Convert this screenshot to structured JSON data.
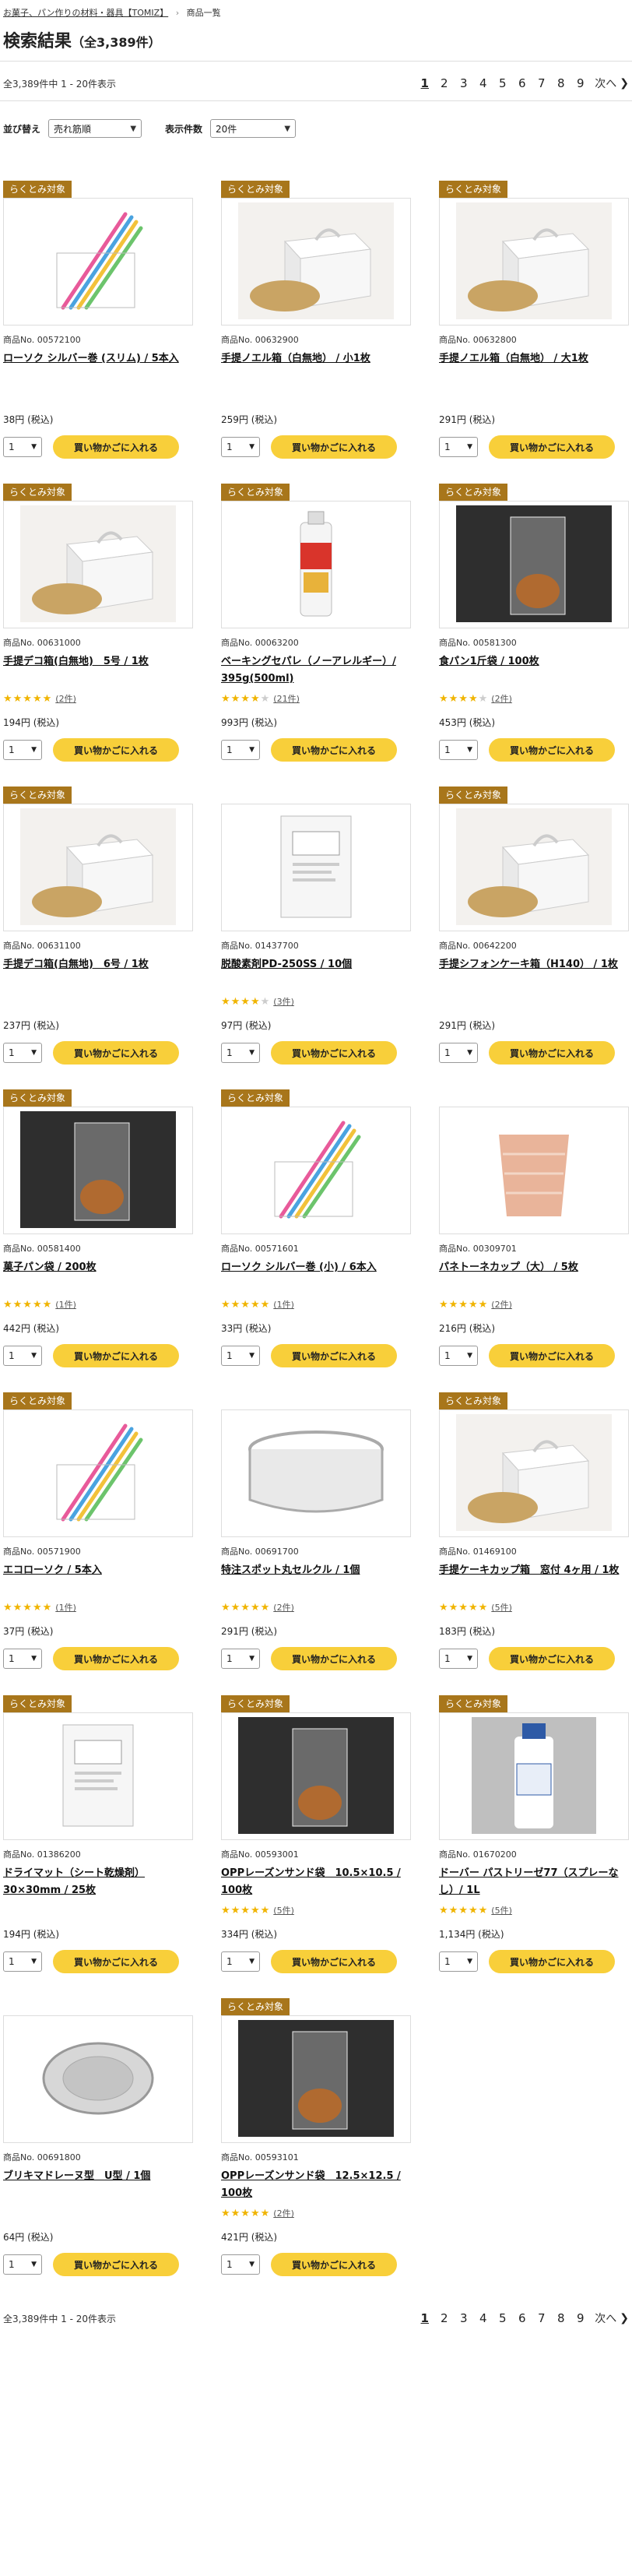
{
  "breadcrumb": {
    "home": "お菓子、パン作りの材料・器具【TOMIZ】",
    "current": "商品一覧"
  },
  "page": {
    "title": "検索結果",
    "count": "（全3,389件）"
  },
  "pagination": {
    "summary": "全3,389件中 1 - 20件表示",
    "pages": [
      "1",
      "2",
      "3",
      "4",
      "5",
      "6",
      "7",
      "8",
      "9"
    ],
    "current": "1",
    "next_label": "次へ"
  },
  "controls": {
    "sort_label": "並び替え",
    "sort_value": "売れ筋順",
    "per_page_label": "表示件数",
    "per_page_value": "20件"
  },
  "labels": {
    "badge": "らくとみ対象",
    "pno_prefix": "商品No. ",
    "qty": "1",
    "cart_button": "買い物かごに入れる"
  },
  "products": [
    {
      "badge": true,
      "no": "00572100",
      "name": "ローソク シルバー巻 (スリム) / 5本入",
      "rating": 0,
      "reviews": "",
      "price": "38円 (税込)",
      "icon": "candle-image"
    },
    {
      "badge": true,
      "no": "00632900",
      "name": "手提ノエル箱（白無地） / 小1枚",
      "rating": 0,
      "reviews": "",
      "price": "259円 (税込)",
      "icon": "box-image"
    },
    {
      "badge": true,
      "no": "00632800",
      "name": "手提ノエル箱（白無地） / 大1枚",
      "rating": 0,
      "reviews": "",
      "price": "291円 (税込)",
      "icon": "box-image"
    },
    {
      "badge": true,
      "no": "00631000",
      "name": "手提デコ箱(白無地)　5号 / 1枚",
      "rating": 5,
      "reviews": "(2件)",
      "price": "194円 (税込)",
      "icon": "box-image"
    },
    {
      "badge": true,
      "no": "00063200",
      "name": "ベーキングセパレ（ノーアレルギー）/ 395g(500ml)",
      "rating": 4,
      "reviews": "(21件)",
      "price": "993円 (税込)",
      "icon": "spray-image"
    },
    {
      "badge": true,
      "no": "00581300",
      "name": "食パン1斤袋 / 100枚",
      "rating": 4,
      "reviews": "(2件)",
      "price": "453円 (税込)",
      "icon": "bag-image"
    },
    {
      "badge": true,
      "no": "00631100",
      "name": "手提デコ箱(白無地)　6号 / 1枚",
      "rating": 0,
      "reviews": "",
      "price": "237円 (税込)",
      "icon": "box-image"
    },
    {
      "badge": false,
      "no": "01437700",
      "name": "脱酸素剤PD-250SS / 10個",
      "rating": 4,
      "reviews": "(3件)",
      "price": "97円 (税込)",
      "icon": "packet-image"
    },
    {
      "badge": true,
      "no": "00642200",
      "name": "手提シフォンケーキ箱（H140） / 1枚",
      "rating": 0,
      "reviews": "",
      "price": "291円 (税込)",
      "icon": "box-image"
    },
    {
      "badge": true,
      "no": "00581400",
      "name": "菓子パン袋 / 200枚",
      "rating": 5,
      "reviews": "(1件)",
      "price": "442円 (税込)",
      "icon": "bag-image"
    },
    {
      "badge": true,
      "no": "00571601",
      "name": "ローソク シルバー巻 (小) / 6本入",
      "rating": 5,
      "reviews": "(1件)",
      "price": "33円 (税込)",
      "icon": "candle-image"
    },
    {
      "badge": false,
      "no": "00309701",
      "name": "パネトーネカップ（大） / 5枚",
      "rating": 5,
      "reviews": "(2件)",
      "price": "216円 (税込)",
      "icon": "cup-image"
    },
    {
      "badge": true,
      "no": "00571900",
      "name": "エコローソク / 5本入",
      "rating": 5,
      "reviews": "(1件)",
      "price": "37円 (税込)",
      "icon": "candle-image"
    },
    {
      "badge": false,
      "no": "00691700",
      "name": "特注スポット丸セルクル / 1個",
      "rating": 5,
      "reviews": "(2件)",
      "price": "291円 (税込)",
      "icon": "ring-image"
    },
    {
      "badge": true,
      "no": "01469100",
      "name": "手提ケーキカップ箱　窓付 4ヶ用 / 1枚",
      "rating": 5,
      "reviews": "(5件)",
      "price": "183円 (税込)",
      "icon": "box-image"
    },
    {
      "badge": true,
      "no": "01386200",
      "name": "ドライマット（シート乾燥剤）30×30mm / 25枚",
      "rating": 0,
      "reviews": "",
      "price": "194円 (税込)",
      "icon": "packet-image"
    },
    {
      "badge": true,
      "no": "00593001",
      "name": "OPPレーズンサンド袋　10.5×10.5 / 100枚",
      "rating": 5,
      "reviews": "(5件)",
      "price": "334円 (税込)",
      "icon": "bag-image"
    },
    {
      "badge": true,
      "no": "01670200",
      "name": "ドーバー パストリーゼ77（スプレーなし）/ 1L",
      "rating": 5,
      "reviews": "(5件)",
      "price": "1,134円 (税込)",
      "icon": "bottle-image"
    },
    {
      "badge": false,
      "no": "00691800",
      "name": "ブリキマドレーヌ型　U型 / 1個",
      "rating": 0,
      "reviews": "",
      "price": "64円 (税込)",
      "icon": "tin-image"
    },
    {
      "badge": true,
      "no": "00593101",
      "name": "OPPレーズンサンド袋　12.5×12.5 / 100枚",
      "rating": 5,
      "reviews": "(2件)",
      "price": "421円 (税込)",
      "icon": "bag-image"
    }
  ],
  "colors": {
    "badge": "#a8761b",
    "cart_button": "#f8cf3a",
    "star": "#f0b400"
  }
}
